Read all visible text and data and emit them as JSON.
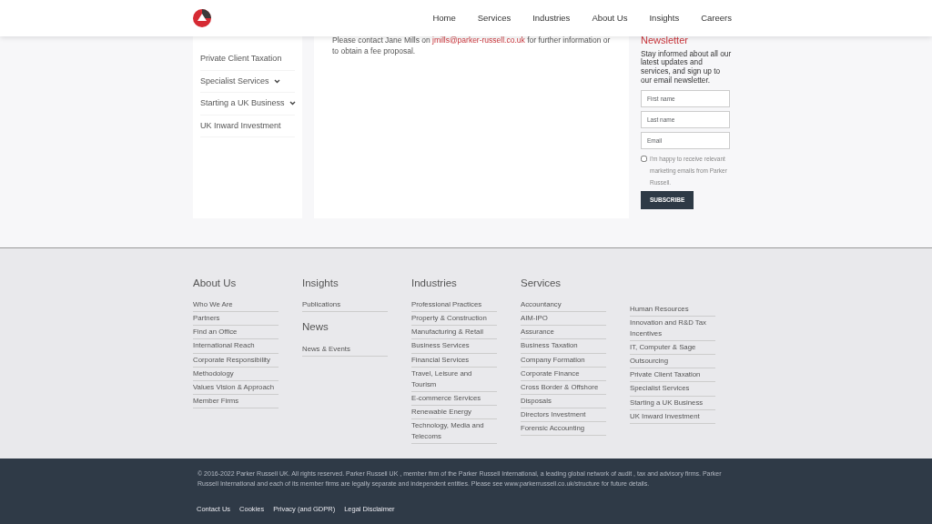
{
  "header": {
    "nav": [
      "Home",
      "Services",
      "Industries",
      "About Us",
      "Insights",
      "Careers"
    ]
  },
  "sidebar": {
    "items": [
      {
        "label": "Private Client Taxation",
        "expandable": false
      },
      {
        "label": "Specialist Services",
        "expandable": true
      },
      {
        "label": "Starting a UK Business",
        "expandable": true
      },
      {
        "label": "UK Inward Investment",
        "expandable": false
      }
    ]
  },
  "content": {
    "text": "Please contact Jane Mills on ",
    "email": "jmills@parker-russell.co.uk",
    "text_after": " for further information or to obtain a fee proposal."
  },
  "newsletter": {
    "title": "Newsletter",
    "intro": "Stay informed about all our latest updates and services, and sign up to our email newsletter.",
    "fields": [
      {
        "placeholder": "First name"
      },
      {
        "placeholder": "Last name"
      },
      {
        "placeholder": "Email"
      }
    ],
    "consent": {
      "label": "I'm happy to receive relevant marketing emails from Parker Russell.",
      "checked": false
    },
    "button": "SUBSCRIBE"
  },
  "footer": {
    "columns": [
      {
        "groups": [
          {
            "heading": "About Us",
            "links": [
              "Who We Are",
              "Partners",
              "Find an Office",
              "International Reach",
              "Corporate Responsibility",
              "Methodology",
              "Values Vision & Approach",
              "Member Firms"
            ]
          }
        ]
      },
      {
        "groups": [
          {
            "heading": "Insights",
            "links": [
              "Publications"
            ]
          },
          {
            "heading": "News",
            "links": [
              "News & Events"
            ]
          }
        ]
      },
      {
        "groups": [
          {
            "heading": "Industries",
            "links": [
              "Professional Practices",
              "Property & Construction",
              "Manufacturing & Retail",
              "Business Services",
              "Financial Services",
              "Travel, Leisure and Tourism",
              "E-commerce Services",
              "Renewable Energy",
              "Technology, Media and Telecoms"
            ]
          }
        ]
      },
      {
        "groups": [
          {
            "heading": "Services",
            "links": [
              "Accountancy",
              "AIM-IPO",
              "Assurance",
              "Business Taxation",
              "Company Formation",
              "Corporate Finance",
              "Cross Border & Offshore",
              "Disposals",
              "Directors Investment",
              "Forensic Accounting"
            ]
          }
        ]
      },
      {
        "groups": [
          {
            "links": [
              "Human Resources",
              "Innovation and R&D Tax Incentives",
              "IT, Computer & Sage",
              "Outsourcing",
              "Private Client Taxation",
              "Specialist Services",
              "Starting a UK Business",
              "UK Inward Investment"
            ]
          }
        ]
      }
    ]
  },
  "legal": {
    "copyright": "© 2016-2022 Parker Russell UK. All rights reserved. Parker Russell UK , member firm of the Parker Russell International, a leading global network of audit , tax and advisory firms. Parker Russell International and each of its member firms are legally separate and independent entities. Please see www.parkerrussell.co.uk/structure for future details.",
    "links": [
      "Contact Us",
      "Cookies",
      "Privacy (and GDPR)",
      "Legal Disclaimer"
    ]
  }
}
